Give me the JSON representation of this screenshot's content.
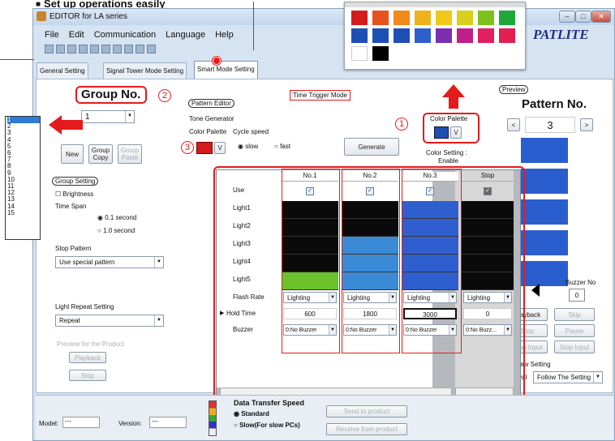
{
  "heading": "Set up operations easily",
  "window": {
    "title": "EDITOR for LA series",
    "brand": "PATLITE"
  },
  "menu": [
    "File",
    "Edit",
    "Communication",
    "Language",
    "Help"
  ],
  "tabs": [
    "General Setting",
    "Signal Tower Mode Setting",
    "Smart Mode Setting"
  ],
  "group": {
    "title": "Group No.",
    "value": "1",
    "new": "New",
    "copy": "Group Copy",
    "paste": "Group Paste"
  },
  "group_setting": {
    "label": "Group Setting",
    "brightness": "Brightness",
    "time_span": "Time Span",
    "ts1": "0.1 second",
    "ts2": "1.0 second",
    "stop_pattern": "Stop Pattern",
    "stop_value": "Use special pattern",
    "light_repeat": "Light Repeat Setting",
    "repeat_value": "Repeat",
    "preview_label": "Preview for the Product",
    "playback": "Playback",
    "stop": "Stop"
  },
  "pattern_editor": {
    "label": "Pattern Editor",
    "tone": "Tone Generator",
    "color_palette": "Color Palette",
    "cycle_speed": "Cycle speed",
    "slow": "slow",
    "fast": "fast",
    "generate": "Generate"
  },
  "time_trigger": "Time Trigger Mode",
  "color_setting": {
    "label": "Color Palette",
    "v": "V",
    "enable_label": "Color Setting :",
    "enable_value": "Enable"
  },
  "preview": {
    "label": "Preview",
    "pattern_no": "Pattern No.",
    "value": "3",
    "buzzer_no": "Buzzer No",
    "buzzer_value": "0",
    "playback": "Playback",
    "skip": "Skip",
    "stop": "Stop",
    "pause": "Pause",
    "view_input": "View Input",
    "stop_input": "Stop Input",
    "setting": "Preview Setting",
    "interval": "Interval",
    "interval_value": "Follow The Setting"
  },
  "grid": {
    "columns": [
      "No.1",
      "No.2",
      "No.3",
      "Stop"
    ],
    "rows": [
      "Use",
      "Light1",
      "Light2",
      "Light3",
      "Light4",
      "Light5",
      "Flash Rate",
      "Hold Time",
      "Buzzer"
    ],
    "flash": [
      "Lighting",
      "Lighting",
      "Lighting",
      "Lighting"
    ],
    "hold": [
      "600",
      "1800",
      "3000",
      "0"
    ],
    "buzzer": [
      "0:No Buzzer",
      "0:No Buzzer",
      "0:No Buzzer",
      "0:No Buzz..."
    ],
    "light_colors": [
      [
        "#0a0a0a",
        "#0a0a0a",
        "#2f5fcf",
        "#0a0a0a"
      ],
      [
        "#0a0a0a",
        "#0a0a0a",
        "#2f5fcf",
        "#0a0a0a"
      ],
      [
        "#0a0a0a",
        "#3a8ad6",
        "#2f5fcf",
        "#0a0a0a"
      ],
      [
        "#0a0a0a",
        "#3a8ad6",
        "#2f5fcf",
        "#0a0a0a"
      ],
      [
        "#6ac12a",
        "#3a8ad6",
        "#2f5fcf",
        "#0a0a0a"
      ]
    ]
  },
  "bottom": {
    "model": "Model:",
    "model_value": "---",
    "version": "Version:",
    "version_value": "---",
    "transfer": "Data Transfer Speed",
    "standard": "Standard",
    "slow": "Slow(For slow PCs)",
    "send": "Send to product",
    "receive": "Receive from product"
  },
  "group_list": [
    "1",
    "2",
    "3",
    "4",
    "5",
    "6",
    "7",
    "8",
    "9",
    "10",
    "11",
    "12",
    "13",
    "14",
    "15"
  ],
  "markers": {
    "m1": "1",
    "m2": "2",
    "m3": "3"
  },
  "accent": "#e51a1a"
}
